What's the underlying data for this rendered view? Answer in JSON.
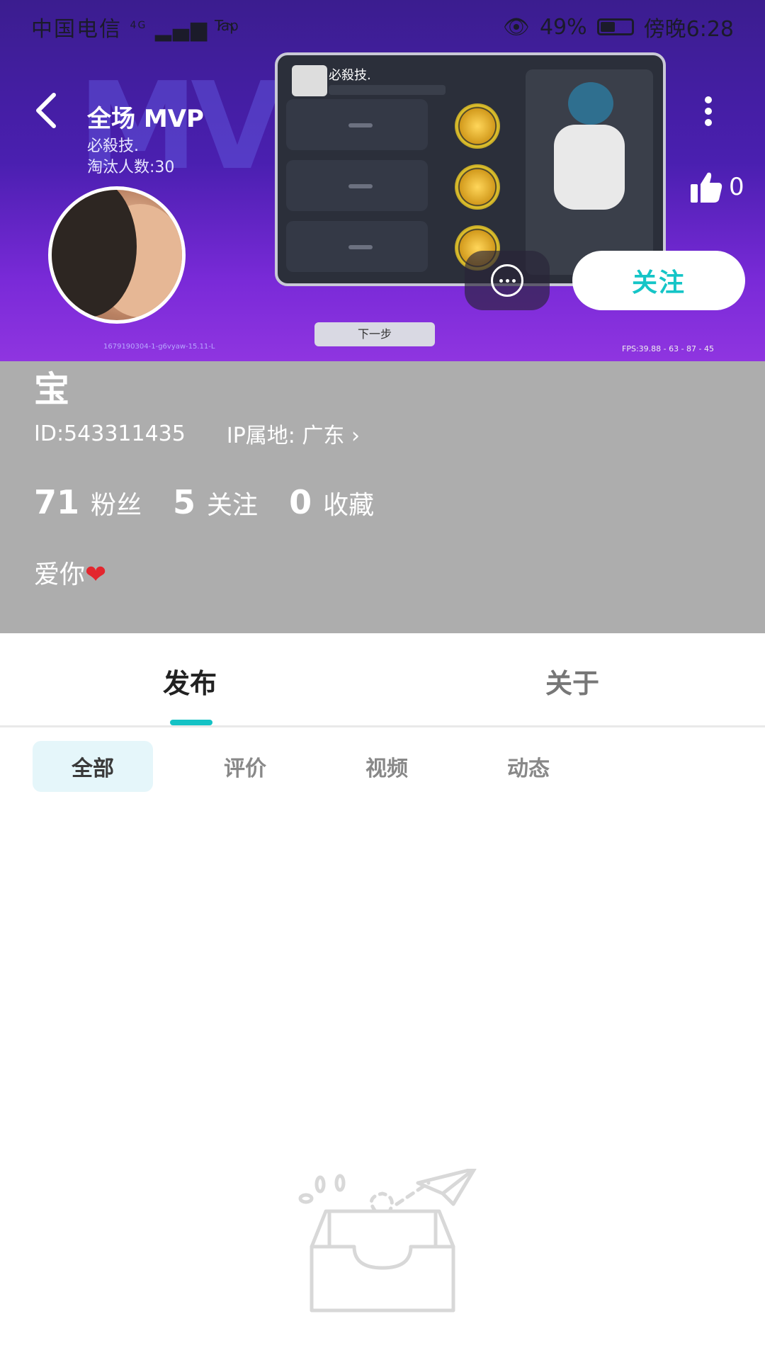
{
  "status_bar": {
    "carrier": "中国电信",
    "network": "4G",
    "app_tag": "Tap",
    "battery": "49%",
    "time": "傍晚6:28"
  },
  "banner": {
    "mvp_title": "全场 MVP",
    "player": "必殺技.",
    "eliminations": "淘汰人数:30",
    "card_player": "必殺技.",
    "next_button": "下一步",
    "image_id": "1679190304-1-g6vyaw-15.11-L",
    "fps": "FPS:39.88 - 63 - 87 - 45"
  },
  "header": {
    "like_count": "0",
    "follow_label": "关注"
  },
  "profile": {
    "name": "宝",
    "id": "ID:543311435",
    "ip_location": "IP属地: 广东",
    "stats": [
      {
        "value": "71",
        "label": "粉丝"
      },
      {
        "value": "5",
        "label": "关注"
      },
      {
        "value": "0",
        "label": "收藏"
      }
    ],
    "bio": "爱你",
    "bio_emoji": "❤"
  },
  "tabs": [
    {
      "label": "发布",
      "active": true
    },
    {
      "label": "关于",
      "active": false
    }
  ],
  "subtabs": [
    {
      "label": "全部",
      "active": true
    },
    {
      "label": "评价",
      "active": false
    },
    {
      "label": "视频",
      "active": false
    },
    {
      "label": "动态",
      "active": false
    }
  ],
  "colors": {
    "accent": "#14c2c5",
    "info_bg": "#adadad",
    "banner_top": "#3b1d8f",
    "banner_bottom": "#8f35e0"
  }
}
